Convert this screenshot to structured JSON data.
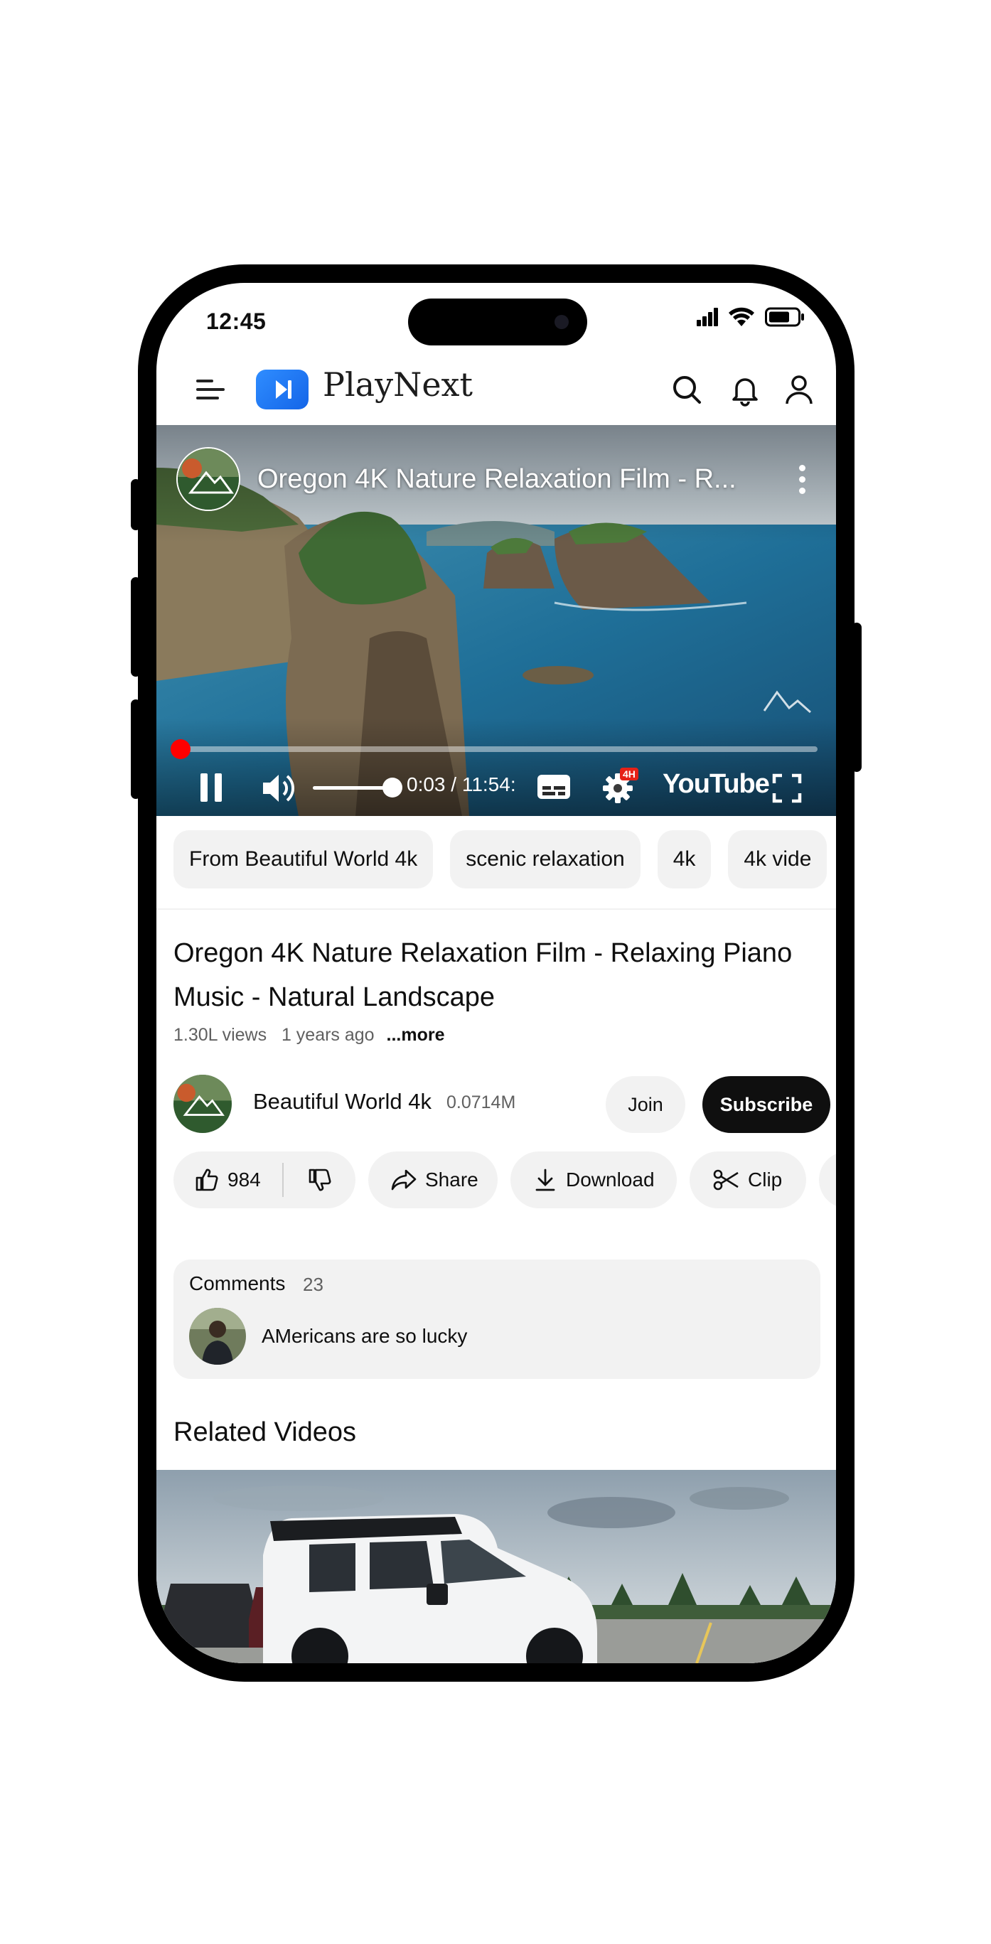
{
  "status_bar": {
    "time": "12:45"
  },
  "app": {
    "name": "PlayNext"
  },
  "player": {
    "title": "Oregon 4K Nature Relaxation Film - R...",
    "time_display": "0:03 / 11:54:",
    "brand": "YouTube",
    "quality_badge": "4H",
    "progress": 0.004,
    "volume": 0.65
  },
  "chips": [
    "From Beautiful World 4k",
    "scenic relaxation",
    "4k",
    "4k vide"
  ],
  "video": {
    "title": "Oregon 4K Nature Relaxation Film - Relaxing Piano Music - Natural Landscape",
    "views": "1.30L views",
    "age": "1 years ago",
    "more": "...more"
  },
  "channel": {
    "name": "Beautiful World 4k",
    "subscribers": "0.0714M",
    "join_label": "Join",
    "subscribe_label": "Subscribe"
  },
  "actions": {
    "likes": "984",
    "share": "Share",
    "download": "Download",
    "clip": "Clip"
  },
  "comments": {
    "label": "Comments",
    "count": "23",
    "top_comment": "AMericans are so lucky"
  },
  "related": {
    "heading": "Related Videos"
  },
  "colors": {
    "accent": "#ff0000",
    "brand_logo": "#1e78f0",
    "subscribe_bg": "#0f0f0f",
    "chip_bg": "#f2f2f2"
  }
}
